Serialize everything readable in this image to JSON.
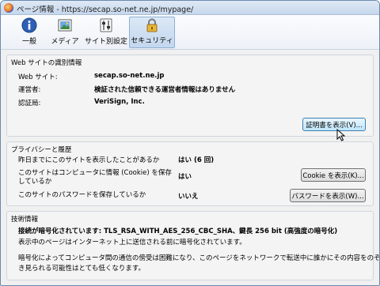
{
  "window": {
    "title": "ページ情報 - https://secap.so-net.ne.jp/mypage/"
  },
  "tabs": [
    {
      "label": "一般",
      "icon": "info-icon"
    },
    {
      "label": "メディア",
      "icon": "media-icon"
    },
    {
      "label": "サイト別設定",
      "icon": "permissions-icon"
    },
    {
      "label": "セキュリティ",
      "icon": "lock-icon",
      "active": true
    }
  ],
  "identity": {
    "heading": "Web サイトの識別情報",
    "website_label": "Web サイト:",
    "website_value": "secap.so-net.ne.jp",
    "owner_label": "運営者:",
    "owner_value": "検証された信頼できる運営者情報はありません",
    "verifier_label": "認証局:",
    "verifier_value": "VeriSign, Inc.",
    "view_cert_button": "証明書を表示(V)..."
  },
  "privacy": {
    "heading": "プライバシーと履歴",
    "visited_question": "昨日までにこのサイトを表示したことがあるか",
    "visited_answer": "はい (6 回)",
    "cookie_question_line1": "このサイトはコンピュータに情報 (Cookie) を保存",
    "cookie_question_line2": "しているか",
    "cookie_answer": "はい",
    "cookie_button": "Cookie を表示(K)...",
    "password_question": "このサイトのパスワードを保存しているか",
    "password_answer": "いいえ",
    "password_button": "パスワードを表示(W)..."
  },
  "technical": {
    "heading": "技術情報",
    "encryption_line": "接続が暗号化されています: TLS_RSA_WITH_AES_256_CBC_SHA、鍵長 256 bit (高強度の暗号化)",
    "encryption_detail": "表示中のページはインターネット上に送信される前に暗号化されています。",
    "eavesdrop_line1": "暗号化によってコンピュータ間の通信の傍受は困難になり、このページをネットワークで転送中に誰かにその内容をのぞ",
    "eavesdrop_line2": "き見られる可能性はとても低くなります。"
  },
  "colors": {
    "accent": "#3c7fb1",
    "group_border": "#cfd6df",
    "window_bg": "#f0f0f0"
  }
}
